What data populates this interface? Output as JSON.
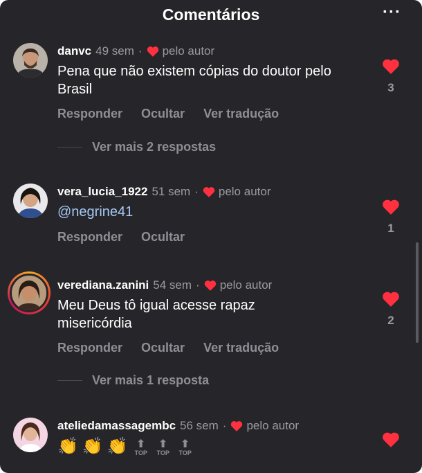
{
  "header": {
    "title": "Comentários",
    "more_label": "···"
  },
  "comments": [
    {
      "username": "danvc",
      "time": "49 sem",
      "author_liked": "pelo autor",
      "text": "Pena que não existem cópias do doutor pelo Brasil",
      "likes": "3",
      "actions": [
        "Responder",
        "Ocultar",
        "Ver tradução"
      ],
      "replies": "Ver mais 2 respostas"
    },
    {
      "username": "vera_lucia_1922",
      "time": "51 sem",
      "author_liked": "pelo autor",
      "text": "@negrine41",
      "likes": "1",
      "actions": [
        "Responder",
        "Ocultar"
      ]
    },
    {
      "username": "verediana.zanini",
      "time": "54 sem",
      "author_liked": "pelo autor",
      "text": "Meu Deus tô igual acesse rapaz misericórdia",
      "likes": "2",
      "actions": [
        "Responder",
        "Ocultar",
        "Ver tradução"
      ],
      "replies": "Ver mais 1 resposta"
    },
    {
      "username": "ateliedamassagembc",
      "time": "56 sem",
      "author_liked": "pelo autor",
      "emojis": [
        "👏",
        "👏",
        "👏"
      ],
      "top_labels": [
        "TOP",
        "TOP",
        "TOP"
      ]
    }
  ],
  "colors": {
    "background": "#26262a",
    "heart": "#ff3040",
    "muted": "#8e8e94",
    "mention": "#a5c8f5"
  }
}
